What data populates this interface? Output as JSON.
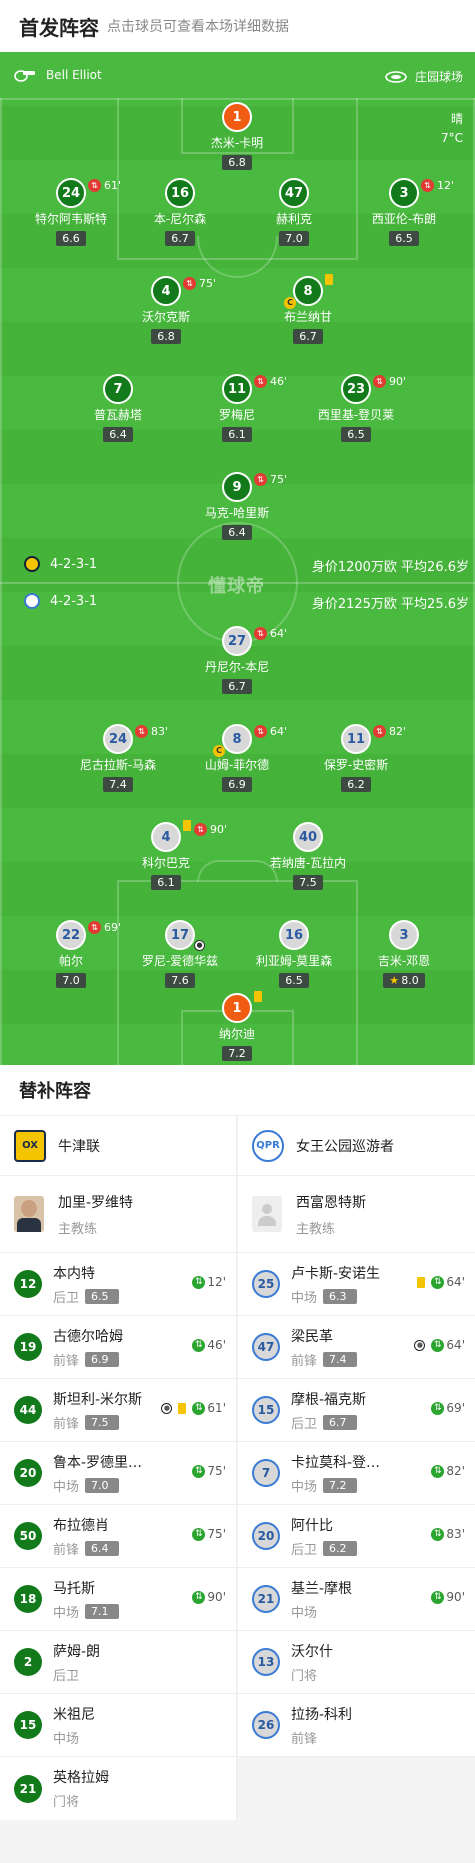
{
  "header": {
    "title": "首发阵容",
    "subtitle": "点击球员可查看本场详细数据"
  },
  "match": {
    "referee": "Bell Elliot",
    "venue": "庄园球场",
    "weather": "晴",
    "temperature": "7°C"
  },
  "home": {
    "formation": "4-2-3-1",
    "value_info": "身价1200万欧 平均26.6岁",
    "name": "牛津联",
    "manager": "加里-罗维特",
    "manager_role": "主教练"
  },
  "away": {
    "formation": "4-2-3-1",
    "value_info": "身价2125万欧 平均25.6岁",
    "name": "女王公园巡游者",
    "manager": "西富恩特斯",
    "manager_role": "主教练"
  },
  "watermark": "懂球帝",
  "home_players": [
    {
      "num": "1",
      "name": "杰米-卡明",
      "rating": "6.8"
    },
    {
      "num": "24",
      "name": "特尔阿韦斯特",
      "rating": "6.6",
      "sub": "61'"
    },
    {
      "num": "16",
      "name": "本-尼尔森",
      "rating": "6.7"
    },
    {
      "num": "47",
      "name": "赫利克",
      "rating": "7.0"
    },
    {
      "num": "3",
      "name": "西亚伦-布朗",
      "rating": "6.5",
      "sub": "12'"
    },
    {
      "num": "4",
      "name": "沃尔克斯",
      "rating": "6.8",
      "sub": "75'"
    },
    {
      "num": "8",
      "name": "布兰纳甘",
      "rating": "6.7"
    },
    {
      "num": "7",
      "name": "普瓦赫塔",
      "rating": "6.4"
    },
    {
      "num": "11",
      "name": "罗梅尼",
      "rating": "6.1",
      "sub": "46'"
    },
    {
      "num": "23",
      "name": "西里基-登贝莱",
      "rating": "6.5",
      "sub": "90'"
    },
    {
      "num": "9",
      "name": "马克-哈里斯",
      "rating": "6.4",
      "sub": "75'"
    }
  ],
  "away_players": [
    {
      "num": "27",
      "name": "丹尼尔-本尼",
      "rating": "6.7",
      "sub": "64'"
    },
    {
      "num": "24",
      "name": "尼古拉斯-马森",
      "rating": "7.4",
      "sub": "83'"
    },
    {
      "num": "8",
      "name": "山姆-菲尔德",
      "rating": "6.9",
      "sub": "64'"
    },
    {
      "num": "11",
      "name": "保罗-史密斯",
      "rating": "6.2",
      "sub": "82'"
    },
    {
      "num": "4",
      "name": "科尔巴克",
      "rating": "6.1",
      "sub": "90'"
    },
    {
      "num": "40",
      "name": "若纳唐-瓦拉内",
      "rating": "7.5"
    },
    {
      "num": "22",
      "name": "帕尔",
      "rating": "7.0",
      "sub": "69'"
    },
    {
      "num": "17",
      "name": "罗尼-爱德华兹",
      "rating": "7.6"
    },
    {
      "num": "16",
      "name": "利亚姆-莫里森",
      "rating": "6.5"
    },
    {
      "num": "3",
      "name": "吉米-邓恩",
      "rating": "8.0"
    },
    {
      "num": "1",
      "name": "纳尔迪",
      "rating": "7.2"
    }
  ],
  "subs_title": "替补阵容",
  "home_subs": [
    {
      "num": "12",
      "name": "本内特",
      "pos": "后卫",
      "rating": "6.5",
      "time": "12'"
    },
    {
      "num": "19",
      "name": "古德尔哈姆",
      "pos": "前锋",
      "rating": "6.9",
      "time": "46'"
    },
    {
      "num": "44",
      "name": "斯坦利-米尔斯",
      "pos": "前锋",
      "rating": "7.5",
      "time": "61'"
    },
    {
      "num": "20",
      "name": "鲁本-罗德里格斯",
      "display": "鲁本-罗德里…",
      "pos": "中场",
      "rating": "7.0",
      "time": "75'"
    },
    {
      "num": "50",
      "name": "布拉德肖",
      "pos": "前锋",
      "rating": "6.4",
      "time": "75'"
    },
    {
      "num": "18",
      "name": "马托斯",
      "pos": "中场",
      "rating": "7.1",
      "time": "90'"
    },
    {
      "num": "2",
      "name": "萨姆-朗",
      "pos": "后卫"
    },
    {
      "num": "15",
      "name": "米祖尼",
      "pos": "中场"
    },
    {
      "num": "21",
      "name": "英格拉姆",
      "pos": "门将"
    }
  ],
  "away_subs": [
    {
      "num": "25",
      "name": "卢卡斯-安诺生",
      "pos": "中场",
      "rating": "6.3",
      "time": "64'"
    },
    {
      "num": "47",
      "name": "梁民革",
      "pos": "前锋",
      "rating": "7.4",
      "time": "64'"
    },
    {
      "num": "15",
      "name": "摩根-福克斯",
      "pos": "后卫",
      "rating": "6.7",
      "time": "69'"
    },
    {
      "num": "7",
      "name": "卡拉莫科-登巴",
      "display": "卡拉莫科-登…",
      "pos": "中场",
      "rating": "7.2",
      "time": "82'"
    },
    {
      "num": "20",
      "name": "阿什比",
      "pos": "后卫",
      "rating": "6.2",
      "time": "83'"
    },
    {
      "num": "21",
      "name": "基兰-摩根",
      "pos": "中场",
      "time": "90'"
    },
    {
      "num": "13",
      "name": "沃尔什",
      "pos": "门将"
    },
    {
      "num": "26",
      "name": "拉扬-科利",
      "pos": "前锋"
    }
  ],
  "colors": {
    "pitch": "#45b33a",
    "home": "#127a1b",
    "goalkeeper": "#f05d12",
    "away_badge": "#d8d8d8",
    "sub_icon": "#e23b33",
    "sub_in": "#2aa52f",
    "yellow_card": "#f5c400"
  }
}
